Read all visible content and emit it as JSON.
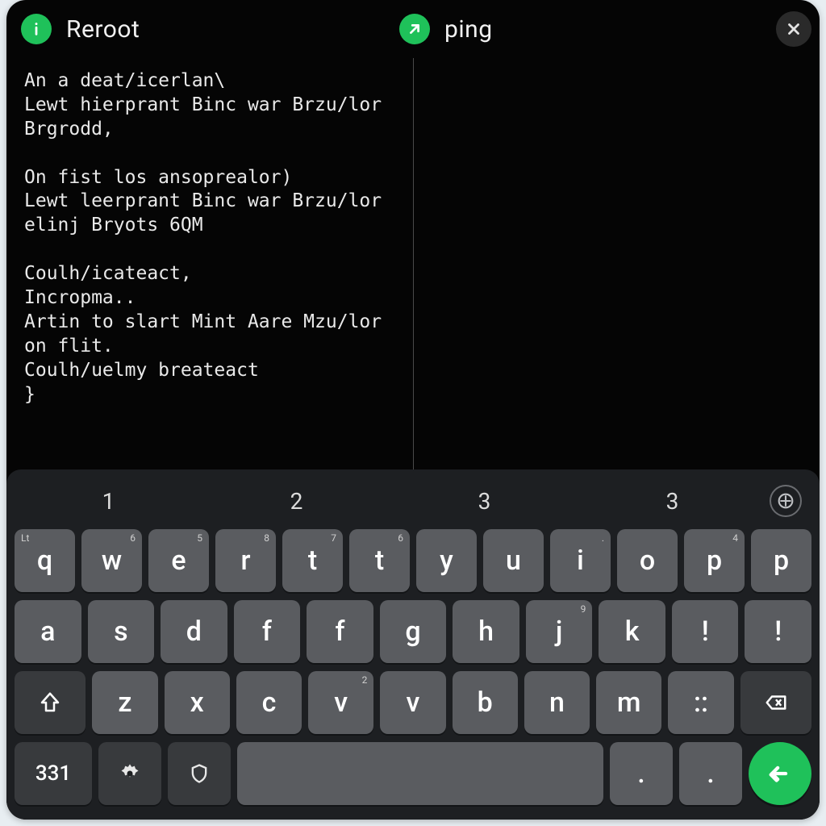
{
  "tabs": [
    {
      "title": "Reroot",
      "icon": "info"
    },
    {
      "title": "ping",
      "icon": "arrow"
    }
  ],
  "panes": {
    "left": "An a deat/icerlan\\\nLewt hierprant Binc war Brzu/lor\nBrgrodd,\n\nOn fist los ansoprealor)\nLewt leerprant Binc war Brzu/lor\nelinj Bryots 6QM\n\nCoulh/icateact,\nIncropma..\nArtin to slart Mint Aare Mzu/lor\non flit.\nCoulh/uelmy breateact\n}",
    "right": ""
  },
  "keyboard": {
    "hints": [
      "1",
      "2",
      "3",
      "3"
    ],
    "row1": [
      {
        "k": "q",
        "hl": "Lt"
      },
      {
        "k": "w",
        "h": "6"
      },
      {
        "k": "e",
        "h": "5"
      },
      {
        "k": "r",
        "h": "8"
      },
      {
        "k": "t",
        "h": "7"
      },
      {
        "k": "t",
        "h": "6"
      },
      {
        "k": "y"
      },
      {
        "k": "u"
      },
      {
        "k": "i",
        "h": "."
      },
      {
        "k": "o"
      },
      {
        "k": "p",
        "h": "4"
      },
      {
        "k": "p",
        "h": ""
      }
    ],
    "row2": [
      {
        "k": "a"
      },
      {
        "k": "s"
      },
      {
        "k": "d"
      },
      {
        "k": "f"
      },
      {
        "k": "f"
      },
      {
        "k": "g"
      },
      {
        "k": "h"
      },
      {
        "k": "j",
        "h": "9"
      },
      {
        "k": "k"
      },
      {
        "k": "!"
      },
      {
        "k": "!"
      }
    ],
    "row3": [
      {
        "k": "z"
      },
      {
        "k": "x"
      },
      {
        "k": "c"
      },
      {
        "k": "v",
        "h": "2"
      },
      {
        "k": "v"
      },
      {
        "k": "b"
      },
      {
        "k": "n"
      },
      {
        "k": "m"
      },
      {
        "k": "::"
      }
    ],
    "numLabel": "331",
    "dots": [
      ".",
      "."
    ]
  }
}
